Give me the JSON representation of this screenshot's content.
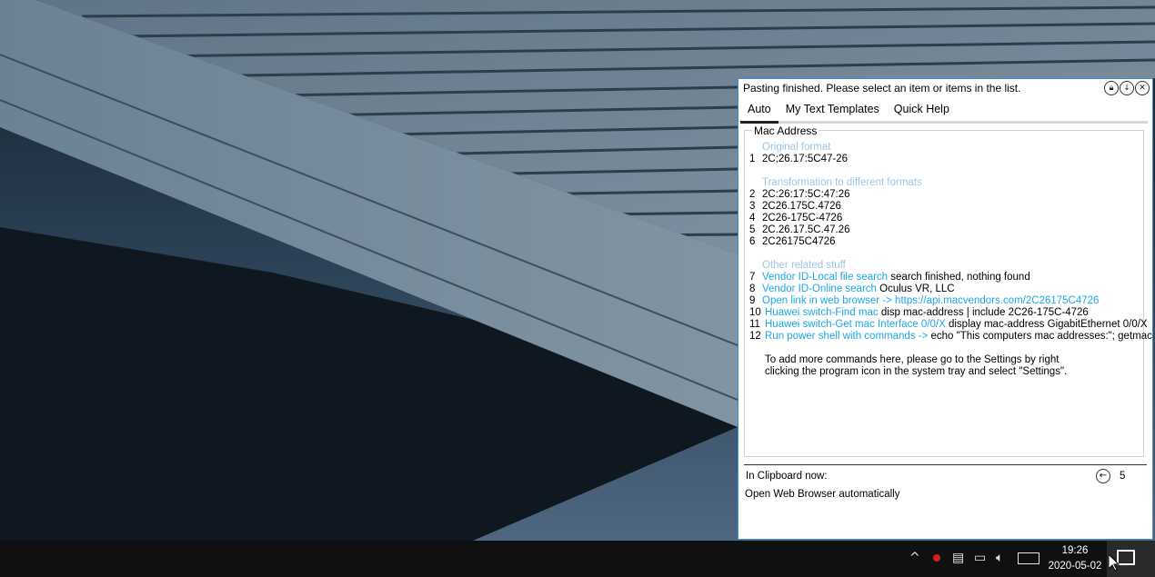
{
  "window": {
    "status": "Pasting finished. Please select an item or items in the list.",
    "icons": [
      "lock-icon",
      "download-icon",
      "close-icon"
    ]
  },
  "tabs": [
    {
      "label": "Auto",
      "active": true
    },
    {
      "label": "My Text Templates",
      "active": false
    },
    {
      "label": "Quick Help",
      "active": false
    }
  ],
  "group": {
    "title": "Mac Address",
    "original_heading": "Original format",
    "original": {
      "num": "1",
      "text": "2C;26.17:5C47-26"
    },
    "transform_heading": "Transformation to different formats",
    "formats": [
      {
        "num": "2",
        "text": "2C:26:17:5C:47:26"
      },
      {
        "num": "3",
        "text": "2C26.175C.4726"
      },
      {
        "num": "4",
        "text": "2C26-175C-4726"
      },
      {
        "num": "5",
        "text": "2C.26.17.5C.47.26"
      },
      {
        "num": "6",
        "text": "2C26175C4726"
      }
    ],
    "related_heading": "Other related stuff",
    "related": [
      {
        "num": "7",
        "link": "Vendor ID-Local file search",
        "text": " search finished, nothing found"
      },
      {
        "num": "8",
        "link": "Vendor ID-Online search",
        "text": " Oculus VR, LLC"
      },
      {
        "num": "9",
        "link": "Open link in web browser ->  https://api.macvendors.com/2C26175C4726",
        "text": ""
      },
      {
        "num": "10",
        "link": "Huawei switch-Find mac",
        "text": " disp mac-address | include 2C26-175C-4726"
      },
      {
        "num": "11",
        "link": "Huawei switch-Get mac Interface 0/0/X",
        "text": " display mac-address GigabitEthernet 0/0/X"
      },
      {
        "num": "12",
        "link": "Run power shell with commands ->",
        "text": " echo \"This computers mac addresses:\"; getmac"
      }
    ],
    "note_line1": "To add more commands here, please go to the Settings by right",
    "note_line2": "clicking the program icon in the system tray and select \"Settings\"."
  },
  "clipboard": {
    "label": "In Clipboard now:",
    "count": "5",
    "value": "Open Web Browser automatically"
  },
  "taskbar": {
    "time": "19:26",
    "date": "2020-05-02"
  },
  "colors": {
    "link": "#1ca7e6",
    "section_heading": "#9dc5e8",
    "window_border": "#3b8ed6",
    "taskbar": "#101010"
  }
}
